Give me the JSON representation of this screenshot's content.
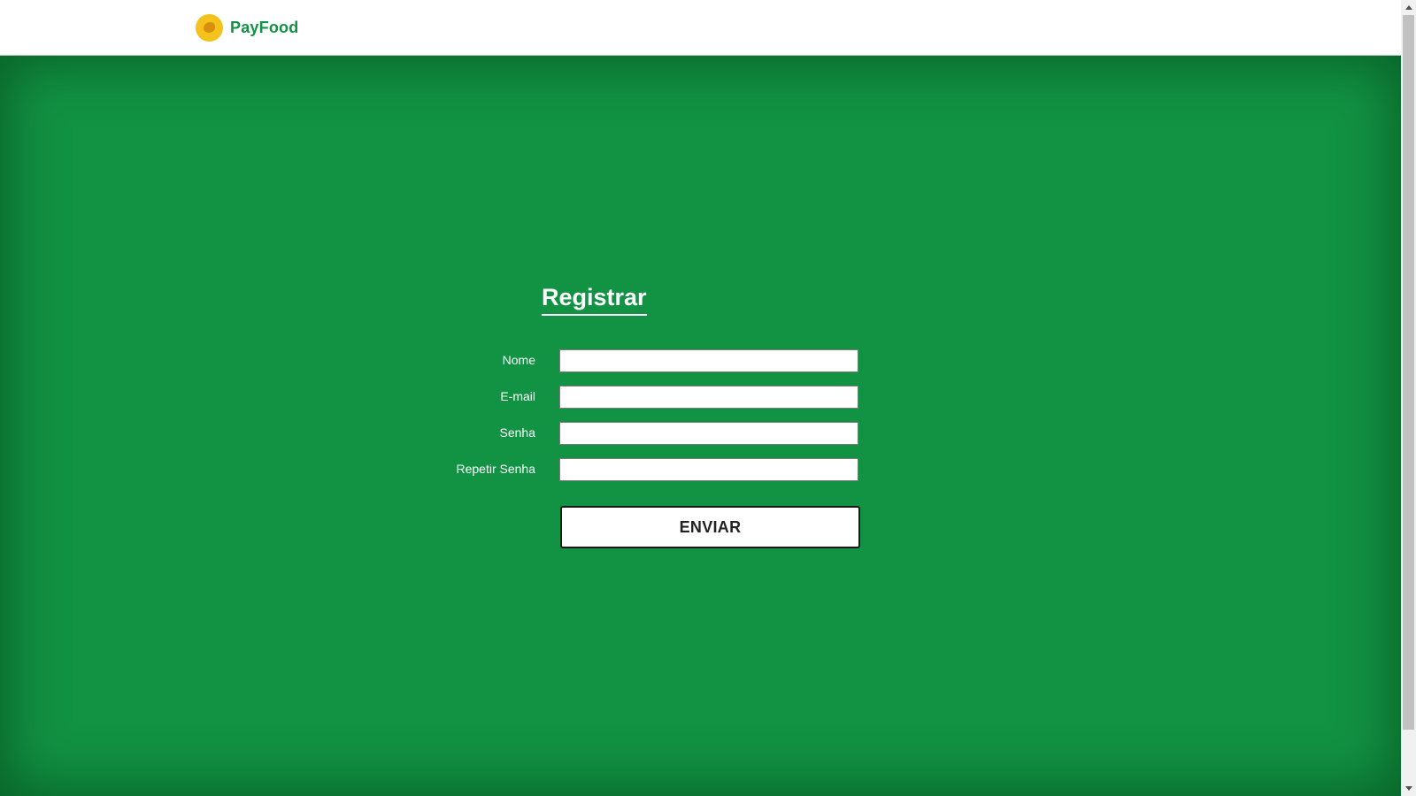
{
  "navbar": {
    "brand_name": "PayFood",
    "logo_icon": "payfood-logo-icon"
  },
  "colors": {
    "brand_green": "#129245",
    "background_green": "#129243",
    "logo_yellow": "#f4c21c"
  },
  "form": {
    "title": "Registrar",
    "fields": [
      {
        "label": "Nome",
        "value": "",
        "placeholder": ""
      },
      {
        "label": "E-mail",
        "value": "",
        "placeholder": ""
      },
      {
        "label": "Senha",
        "value": "",
        "placeholder": ""
      },
      {
        "label": "Repetir Senha",
        "value": "",
        "placeholder": ""
      }
    ],
    "submit_label": "ENVIAR"
  }
}
